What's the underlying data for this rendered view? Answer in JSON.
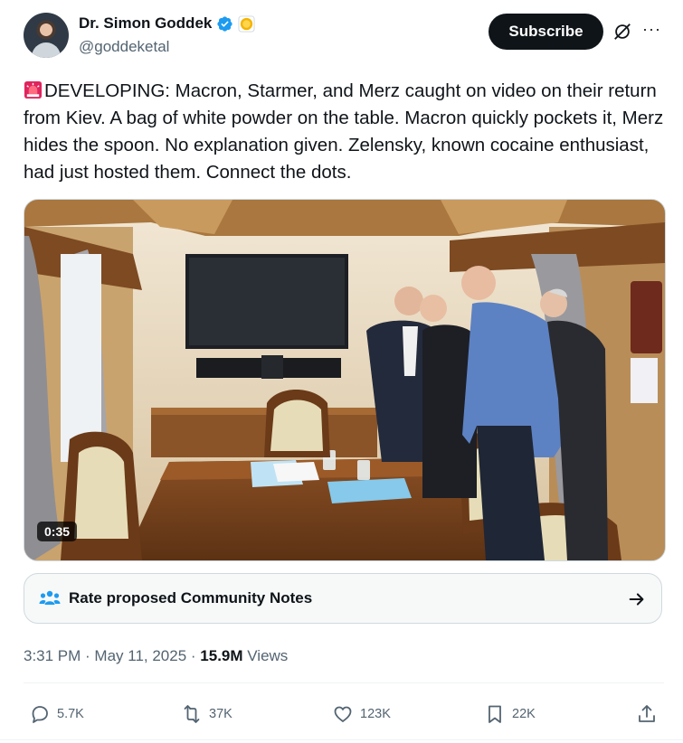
{
  "author": {
    "display_name": "Dr. Simon Goddek",
    "handle": "@goddeketal"
  },
  "header": {
    "subscribe_label": "Subscribe",
    "more_label": "···"
  },
  "tweet": {
    "text": "DEVELOPING: Macron, Starmer, and Merz caught on video on their return from Kiev. A bag of white powder on the table. Macron quickly pockets it, Merz hides the spoon. No explanation given. Zelensky, known cocaine enthusiast, had just hosted them. Connect the dots.",
    "leading_emoji": "rotating-light-icon"
  },
  "media": {
    "duration": "0:35"
  },
  "community_notes": {
    "label": "Rate proposed Community Notes"
  },
  "meta": {
    "time": "3:31 PM",
    "separator1": " · ",
    "date": "May 11, 2025",
    "separator2": " · ",
    "views_count": "15.9M",
    "views_label": " Views"
  },
  "actions": {
    "replies": "5.7K",
    "reposts": "37K",
    "likes": "123K",
    "bookmarks": "22K"
  },
  "colors": {
    "accent_dark": "#0f1419",
    "secondary_text": "#536471",
    "verified_blue": "#1d9bf0",
    "notes_blue": "#1d9bf0"
  }
}
